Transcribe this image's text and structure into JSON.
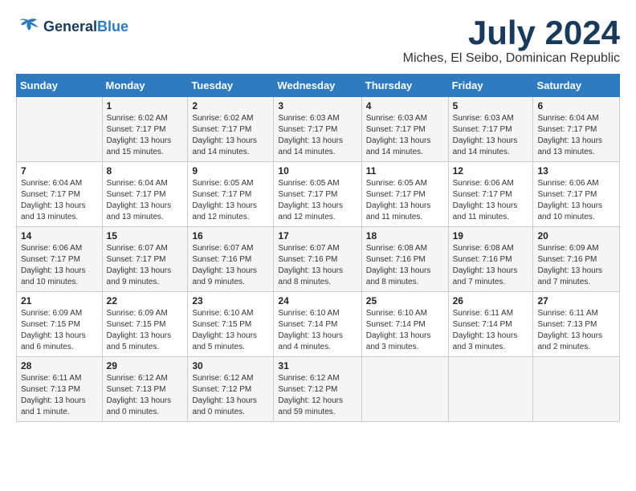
{
  "logo": {
    "line1": "General",
    "line2": "Blue"
  },
  "title": "July 2024",
  "location": "Miches, El Seibo, Dominican Republic",
  "days_header": [
    "Sunday",
    "Monday",
    "Tuesday",
    "Wednesday",
    "Thursday",
    "Friday",
    "Saturday"
  ],
  "weeks": [
    [
      {
        "day": "",
        "sunrise": "",
        "sunset": "",
        "daylight": ""
      },
      {
        "day": "1",
        "sunrise": "Sunrise: 6:02 AM",
        "sunset": "Sunset: 7:17 PM",
        "daylight": "Daylight: 13 hours and 15 minutes."
      },
      {
        "day": "2",
        "sunrise": "Sunrise: 6:02 AM",
        "sunset": "Sunset: 7:17 PM",
        "daylight": "Daylight: 13 hours and 14 minutes."
      },
      {
        "day": "3",
        "sunrise": "Sunrise: 6:03 AM",
        "sunset": "Sunset: 7:17 PM",
        "daylight": "Daylight: 13 hours and 14 minutes."
      },
      {
        "day": "4",
        "sunrise": "Sunrise: 6:03 AM",
        "sunset": "Sunset: 7:17 PM",
        "daylight": "Daylight: 13 hours and 14 minutes."
      },
      {
        "day": "5",
        "sunrise": "Sunrise: 6:03 AM",
        "sunset": "Sunset: 7:17 PM",
        "daylight": "Daylight: 13 hours and 14 minutes."
      },
      {
        "day": "6",
        "sunrise": "Sunrise: 6:04 AM",
        "sunset": "Sunset: 7:17 PM",
        "daylight": "Daylight: 13 hours and 13 minutes."
      }
    ],
    [
      {
        "day": "7",
        "sunrise": "Sunrise: 6:04 AM",
        "sunset": "Sunset: 7:17 PM",
        "daylight": "Daylight: 13 hours and 13 minutes."
      },
      {
        "day": "8",
        "sunrise": "Sunrise: 6:04 AM",
        "sunset": "Sunset: 7:17 PM",
        "daylight": "Daylight: 13 hours and 13 minutes."
      },
      {
        "day": "9",
        "sunrise": "Sunrise: 6:05 AM",
        "sunset": "Sunset: 7:17 PM",
        "daylight": "Daylight: 13 hours and 12 minutes."
      },
      {
        "day": "10",
        "sunrise": "Sunrise: 6:05 AM",
        "sunset": "Sunset: 7:17 PM",
        "daylight": "Daylight: 13 hours and 12 minutes."
      },
      {
        "day": "11",
        "sunrise": "Sunrise: 6:05 AM",
        "sunset": "Sunset: 7:17 PM",
        "daylight": "Daylight: 13 hours and 11 minutes."
      },
      {
        "day": "12",
        "sunrise": "Sunrise: 6:06 AM",
        "sunset": "Sunset: 7:17 PM",
        "daylight": "Daylight: 13 hours and 11 minutes."
      },
      {
        "day": "13",
        "sunrise": "Sunrise: 6:06 AM",
        "sunset": "Sunset: 7:17 PM",
        "daylight": "Daylight: 13 hours and 10 minutes."
      }
    ],
    [
      {
        "day": "14",
        "sunrise": "Sunrise: 6:06 AM",
        "sunset": "Sunset: 7:17 PM",
        "daylight": "Daylight: 13 hours and 10 minutes."
      },
      {
        "day": "15",
        "sunrise": "Sunrise: 6:07 AM",
        "sunset": "Sunset: 7:17 PM",
        "daylight": "Daylight: 13 hours and 9 minutes."
      },
      {
        "day": "16",
        "sunrise": "Sunrise: 6:07 AM",
        "sunset": "Sunset: 7:16 PM",
        "daylight": "Daylight: 13 hours and 9 minutes."
      },
      {
        "day": "17",
        "sunrise": "Sunrise: 6:07 AM",
        "sunset": "Sunset: 7:16 PM",
        "daylight": "Daylight: 13 hours and 8 minutes."
      },
      {
        "day": "18",
        "sunrise": "Sunrise: 6:08 AM",
        "sunset": "Sunset: 7:16 PM",
        "daylight": "Daylight: 13 hours and 8 minutes."
      },
      {
        "day": "19",
        "sunrise": "Sunrise: 6:08 AM",
        "sunset": "Sunset: 7:16 PM",
        "daylight": "Daylight: 13 hours and 7 minutes."
      },
      {
        "day": "20",
        "sunrise": "Sunrise: 6:09 AM",
        "sunset": "Sunset: 7:16 PM",
        "daylight": "Daylight: 13 hours and 7 minutes."
      }
    ],
    [
      {
        "day": "21",
        "sunrise": "Sunrise: 6:09 AM",
        "sunset": "Sunset: 7:15 PM",
        "daylight": "Daylight: 13 hours and 6 minutes."
      },
      {
        "day": "22",
        "sunrise": "Sunrise: 6:09 AM",
        "sunset": "Sunset: 7:15 PM",
        "daylight": "Daylight: 13 hours and 5 minutes."
      },
      {
        "day": "23",
        "sunrise": "Sunrise: 6:10 AM",
        "sunset": "Sunset: 7:15 PM",
        "daylight": "Daylight: 13 hours and 5 minutes."
      },
      {
        "day": "24",
        "sunrise": "Sunrise: 6:10 AM",
        "sunset": "Sunset: 7:14 PM",
        "daylight": "Daylight: 13 hours and 4 minutes."
      },
      {
        "day": "25",
        "sunrise": "Sunrise: 6:10 AM",
        "sunset": "Sunset: 7:14 PM",
        "daylight": "Daylight: 13 hours and 3 minutes."
      },
      {
        "day": "26",
        "sunrise": "Sunrise: 6:11 AM",
        "sunset": "Sunset: 7:14 PM",
        "daylight": "Daylight: 13 hours and 3 minutes."
      },
      {
        "day": "27",
        "sunrise": "Sunrise: 6:11 AM",
        "sunset": "Sunset: 7:13 PM",
        "daylight": "Daylight: 13 hours and 2 minutes."
      }
    ],
    [
      {
        "day": "28",
        "sunrise": "Sunrise: 6:11 AM",
        "sunset": "Sunset: 7:13 PM",
        "daylight": "Daylight: 13 hours and 1 minute."
      },
      {
        "day": "29",
        "sunrise": "Sunrise: 6:12 AM",
        "sunset": "Sunset: 7:13 PM",
        "daylight": "Daylight: 13 hours and 0 minutes."
      },
      {
        "day": "30",
        "sunrise": "Sunrise: 6:12 AM",
        "sunset": "Sunset: 7:12 PM",
        "daylight": "Daylight: 13 hours and 0 minutes."
      },
      {
        "day": "31",
        "sunrise": "Sunrise: 6:12 AM",
        "sunset": "Sunset: 7:12 PM",
        "daylight": "Daylight: 12 hours and 59 minutes."
      },
      {
        "day": "",
        "sunrise": "",
        "sunset": "",
        "daylight": ""
      },
      {
        "day": "",
        "sunrise": "",
        "sunset": "",
        "daylight": ""
      },
      {
        "day": "",
        "sunrise": "",
        "sunset": "",
        "daylight": ""
      }
    ]
  ]
}
